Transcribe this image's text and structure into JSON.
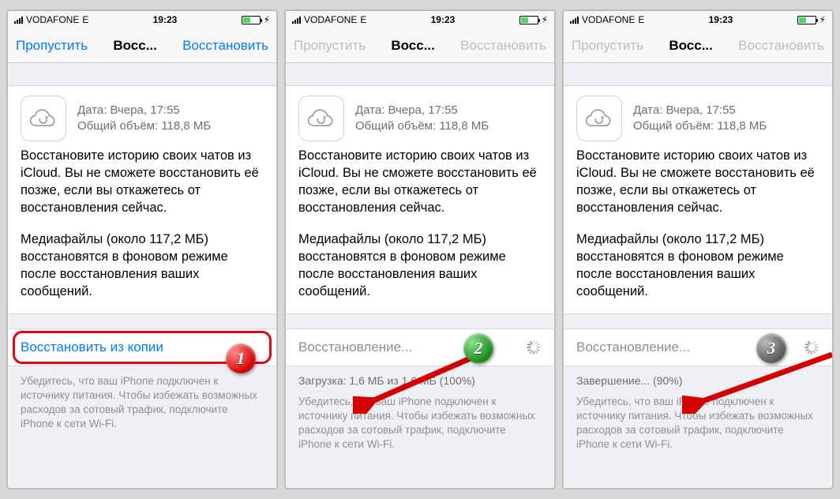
{
  "status": {
    "carrier": "VODAFONE",
    "mobile_net": "E",
    "time": "19:23"
  },
  "nav": {
    "skip": "Пропустить",
    "title": "Восс...",
    "restore": "Восстановить"
  },
  "header": {
    "date_label": "Дата: Вчера, 17:55",
    "size_label": "Общий объём: 118,8 МБ"
  },
  "body": {
    "p1": "Восстановите историю своих чатов из iCloud. Вы не сможете восстановить её позже, если вы откажетесь от восстановления сейчас.",
    "p2": "Медиафайлы (около 117,2 МБ) восстановятся в фоновом режиме после восстановления ваших сообщений."
  },
  "action": {
    "restore_from_copy": "Восстановить из копии",
    "restoring": "Восстановление..."
  },
  "progress": {
    "downloading": "Загрузка: 1,6 МБ из 1,6 МБ (100%)",
    "finishing": "Завершение... (90%)"
  },
  "footer": {
    "text": "Убедитесь, что ваш iPhone подключен к источнику питания. Чтобы избежать возможных расходов за сотовый трафик, подключите iPhone к сети Wi-Fi."
  },
  "steps": {
    "s1": "1",
    "s2": "2",
    "s3": "3"
  }
}
